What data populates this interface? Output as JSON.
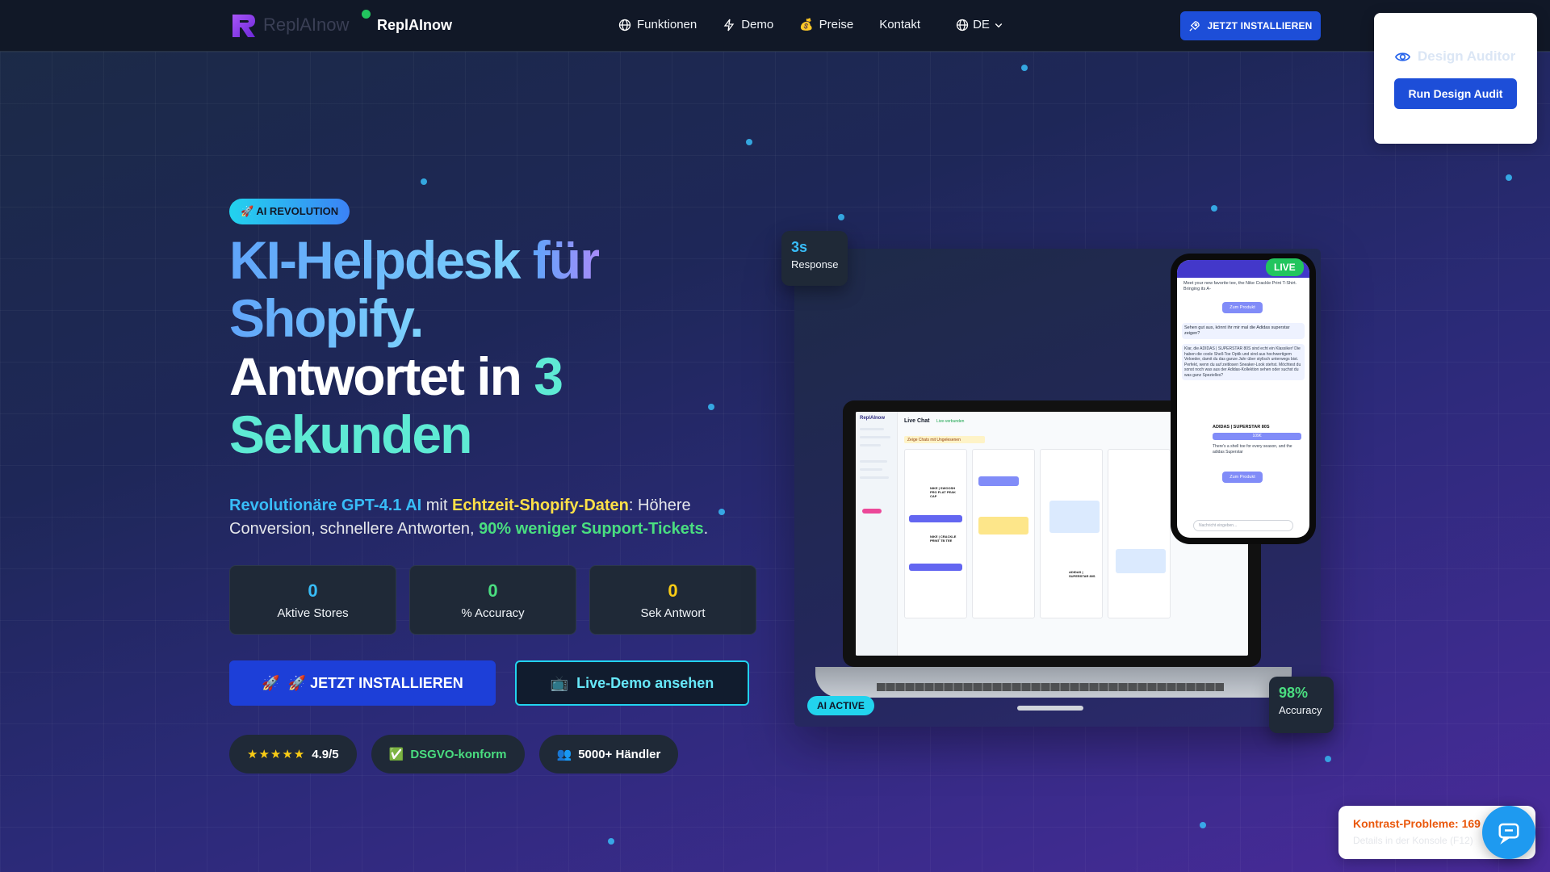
{
  "nav": {
    "brand_ghost": "ReplAInow",
    "brand": "ReplAInow",
    "links": [
      {
        "label": "Funktionen",
        "icon": "globe-icon"
      },
      {
        "label": "Demo",
        "icon": "bolt-icon"
      },
      {
        "label": "Preise",
        "icon": "moneybag-icon"
      },
      {
        "label": "Kontakt",
        "icon": ""
      }
    ],
    "language": "DE",
    "cta": "JETZT INSTALLIEREN"
  },
  "auditor": {
    "title": "Design Auditor",
    "button": "Run Design Audit"
  },
  "hero": {
    "badge": "🚀 AI REVOLUTION",
    "title_line1a": "KI-Helpdesk ",
    "title_line1b": "für",
    "title_line2": "Shopify.",
    "title_line3a": "Antwortet in ",
    "title_line3b": "3",
    "title_line4": "Sekunden",
    "lead": {
      "p1": "Revolutionäre GPT-4.1 AI",
      "p2": " mit ",
      "p3": "Echtzeit-Shopify-Daten",
      "p4": ": Höhere Conversion, schnellere Antworten, ",
      "p5": "90% weniger Support-Tickets",
      "p6": "."
    },
    "stats": [
      {
        "value": "0",
        "label": "Aktive Stores",
        "color": "#38bdf8"
      },
      {
        "value": "0",
        "label": "% Accuracy",
        "color": "#4ade80"
      },
      {
        "value": "0",
        "label": "Sek Antwort",
        "color": "#facc15"
      }
    ],
    "primary_button": "🚀 JETZT INSTALLIEREN",
    "secondary_button": "Live-Demo ansehen",
    "trust": {
      "rating_stars": "★★★★★",
      "rating": "4.9/5",
      "gdpr": "DSGVO-konform",
      "merchants": "5000+ Händler"
    }
  },
  "visual": {
    "response_value": "3s",
    "response_label": "Response",
    "accuracy_value": "98%",
    "accuracy_label": "Accuracy",
    "live_badge": "LIVE",
    "ai_badge": "AI ACTIVE",
    "laptop": {
      "brand": "ReplAInow",
      "title": "Live Chat",
      "status": "Live-verbunden",
      "filter": "Zeige Chats mit Ungelesenen",
      "product1": "NIKE | SWOOSH PRO FLAT PEAK CAP",
      "product2": "NIKE | CRACKLE PRINT TB TEE",
      "product3": "ADIDAS | SUPERSTAR 80S",
      "cta": "Zum Produkt"
    },
    "phone": {
      "msg1": "Meet your new favorite tee, the Nike Crackle Print T-Shirt. Bringing its A-",
      "btn": "Zum Produkt",
      "msg2": "Sehen gut aus, könnt ihr mir mal die Adidas superstar zeigen?",
      "msg3": "Klar, die ADIDAS | SUPERSTAR 80S sind echt ein Klassiker! Die haben die coole Shell-Toe Optik und sind aus hochwertigem Veloeder, damit du das ganze Jahr über stylisch unterwegs bist. Perfekt, wenn du auf zeitlosen Sneaker-Look stehst. Möchtest du sonst noch was aus der Adidas-Kollektion sehen oder suchst du was ganz Spezielles?",
      "product": "ADIDAS | SUPERSTAR 80S",
      "price": "109€",
      "msg4": "There's a shell toe for every season, and the adidas Superstar",
      "input_placeholder": "Nachricht eingeben..."
    }
  },
  "toast": {
    "title": "Kontrast-Probleme: 169",
    "subtitle": "Details in der Konsole (F12)"
  }
}
